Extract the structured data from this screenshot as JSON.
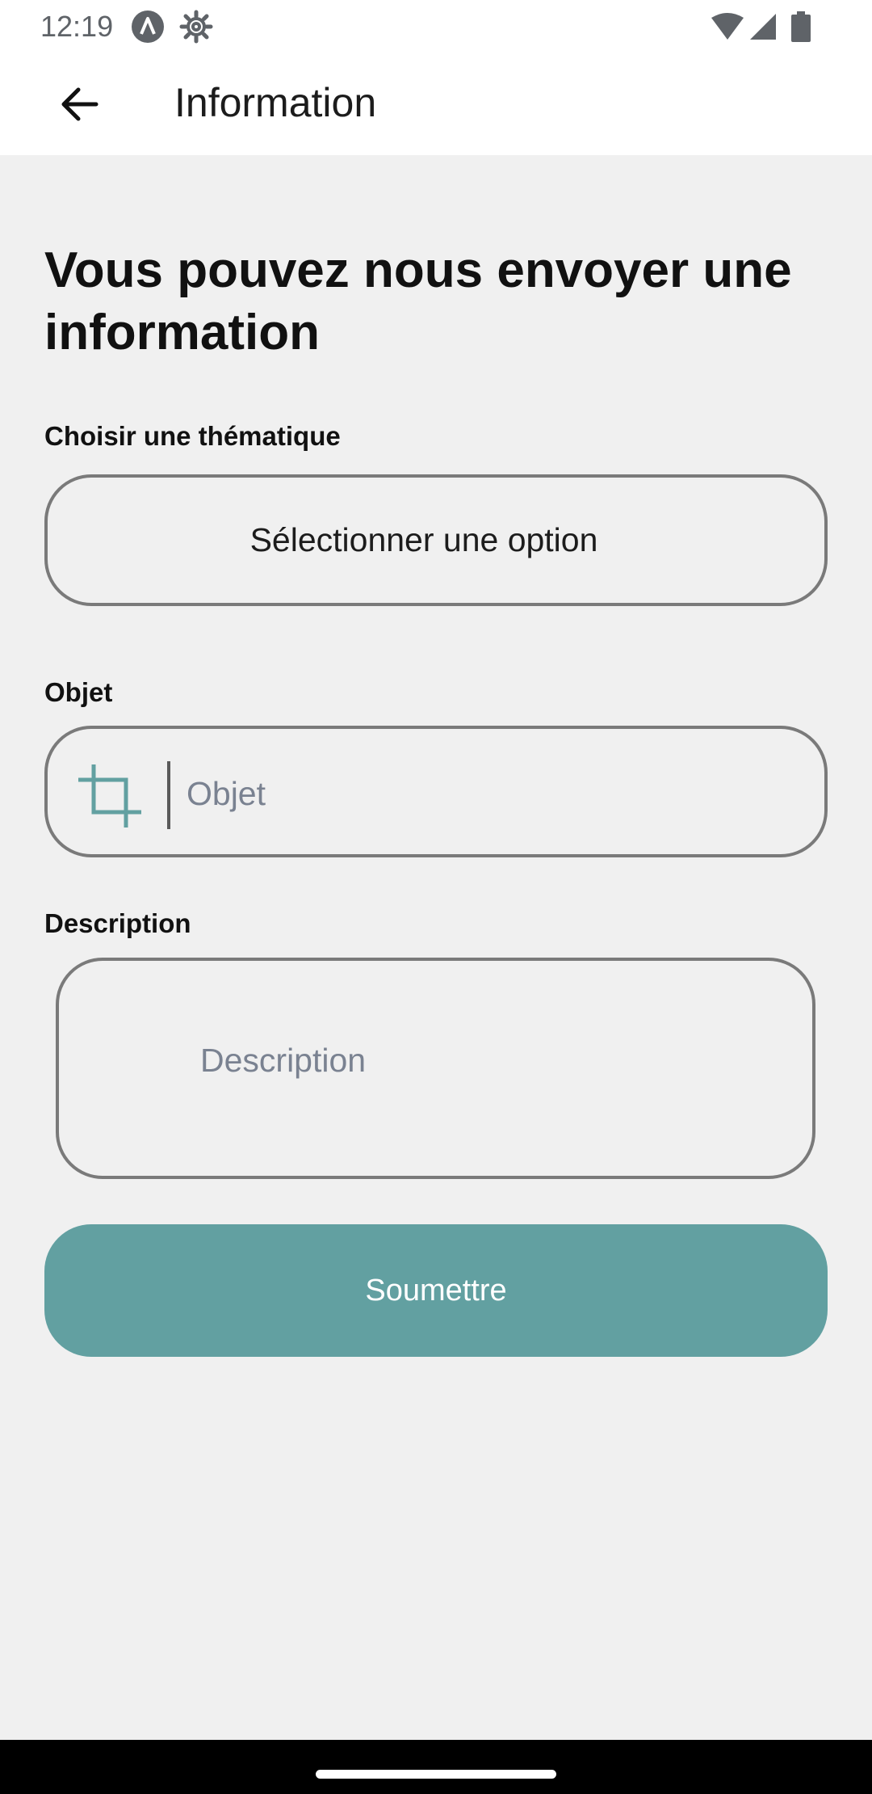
{
  "status_bar": {
    "time": "12:19",
    "icons": [
      "a-icon",
      "gear-icon",
      "wifi-icon",
      "signal-icon",
      "battery-icon"
    ]
  },
  "app_bar": {
    "back_icon": "arrow-left-icon",
    "title": "Information"
  },
  "form": {
    "heading": "Vous pouvez nous envoyer une information",
    "theme": {
      "label": "Choisir une thématique",
      "selected_value": "Sélectionner une option"
    },
    "objet": {
      "label": "Objet",
      "icon": "crop-icon",
      "value": "",
      "placeholder": "Objet"
    },
    "description": {
      "label": "Description",
      "value": "",
      "placeholder": "Description"
    },
    "submit_label": "Soumettre"
  },
  "colors": {
    "accent": "#62a0a1",
    "background": "#f0f0f0",
    "border": "#7a7a7a",
    "placeholder": "#7a8291"
  }
}
